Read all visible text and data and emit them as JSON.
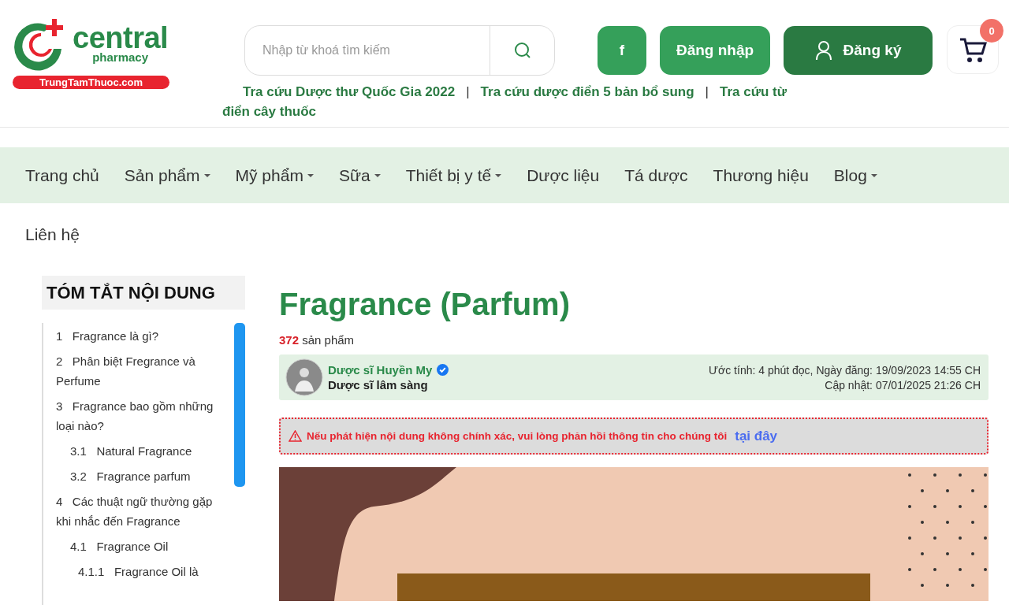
{
  "logo": {
    "name": "central",
    "sub": "pharmacy",
    "domain": "TrungTamThuoc.com"
  },
  "search": {
    "placeholder": "Nhập từ khoá tìm kiếm"
  },
  "header_buttons": [
    {
      "kind": "facebook",
      "label": "f"
    },
    {
      "kind": "login",
      "label": "Đăng nhập"
    },
    {
      "kind": "register",
      "label": "Đăng ký"
    }
  ],
  "cart": {
    "count": "0"
  },
  "quick_link_separator": "|",
  "quick_links": [
    "Tra cứu Dược thư Quốc Gia 2022",
    "Tra cứu dược điển 5 bản bổ sung",
    "Tra cứu từ điển cây thuốc"
  ],
  "nav": [
    {
      "label": "Trang chủ",
      "dropdown": false
    },
    {
      "label": "Sản phẩm",
      "dropdown": true
    },
    {
      "label": "Mỹ phẩm",
      "dropdown": true
    },
    {
      "label": "Sữa",
      "dropdown": true
    },
    {
      "label": "Thiết bị y tế",
      "dropdown": true
    },
    {
      "label": "Dược liệu",
      "dropdown": false
    },
    {
      "label": "Tá dược",
      "dropdown": false
    },
    {
      "label": "Thương hiệu",
      "dropdown": false
    },
    {
      "label": "Blog",
      "dropdown": true
    },
    {
      "label": "Liên hệ",
      "dropdown": false
    }
  ],
  "toc": {
    "title": "TÓM TẮT NỘI DUNG",
    "items": [
      {
        "number": "1",
        "label": "Fragrance là gì?"
      },
      {
        "number": "2",
        "label": "Phân biệt Fregrance và Perfume"
      },
      {
        "number": "3",
        "label": "Fragrance bao gồm những loại nào?",
        "children": [
          {
            "number": "3.1",
            "label": "Natural Fragrance"
          },
          {
            "number": "3.2",
            "label": "Fragrance parfum"
          }
        ]
      },
      {
        "number": "4",
        "label": "Các thuật ngữ thường gặp khi nhắc đến Fragrance",
        "children": [
          {
            "number": "4.1",
            "label": "Fragrance Oil",
            "children": [
              {
                "number": "4.1.1",
                "label": "Fragrance Oil là"
              }
            ]
          }
        ]
      }
    ]
  },
  "article": {
    "title": "Fragrance (Parfum)",
    "count": "372",
    "count_label": "sản phẩm",
    "author": {
      "name": "Dược sĩ Huyền My",
      "verified": true,
      "role": "Dược sĩ lâm sàng",
      "estimate": "Ước tính: 4 phút đọc, Ngày đăng: 19/09/2023 14:55 CH",
      "updated": "Cập nhật: 07/01/2025 21:26 CH"
    },
    "warning": {
      "text": "Nếu phát hiện nội dung không chính xác, vui lòng phản hồi thông tin cho chúng tôi",
      "link": "tại đây"
    }
  }
}
